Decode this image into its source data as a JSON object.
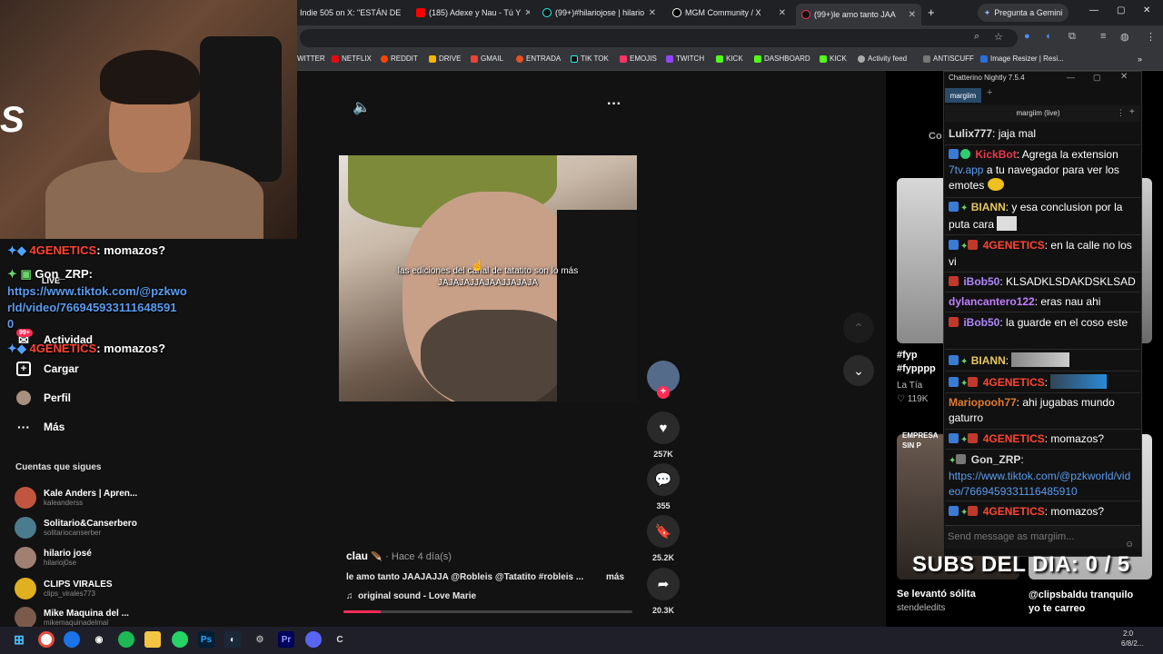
{
  "tabs": [
    {
      "label": "Indie 505 on X: \"ESTÁN DE",
      "icon": "x-icon"
    },
    {
      "label": "(185) Adexe y Nau - Tú Y",
      "icon": "youtube-icon"
    },
    {
      "label": "(99+)#hilariojose | hilario",
      "icon": "tiktok-icon"
    },
    {
      "label": "MGM Community / X",
      "icon": "x-icon"
    },
    {
      "label": "(99+)le amo tanto JAA",
      "icon": "tiktok-icon"
    }
  ],
  "gemini_label": "Pregunta a Gemini",
  "bookmarks": [
    "WITTER",
    "NETFLIX",
    "REDDIT",
    "DRIVE",
    "GMAIL",
    "ENTRADA",
    "TIK TOK",
    "EMOJIS",
    "TWITCH",
    "KICK",
    "DASHBOARD",
    "KICK",
    "Activity feed",
    "ANTISCUFF",
    "Image Resizer | Resi..."
  ],
  "sidebar": {
    "items": [
      {
        "label": "Actividad",
        "icon": "bell-icon",
        "badge": "99+"
      },
      {
        "label": "Cargar",
        "icon": "plus-square-icon"
      },
      {
        "label": "Perfil",
        "icon": "avatar-icon"
      },
      {
        "label": "Más",
        "icon": "more-icon"
      }
    ],
    "following_title": "Cuentas que sigues",
    "following": [
      {
        "name": "Kale Anders | Apren...",
        "user": "kaleanderss",
        "color": "#c2553f"
      },
      {
        "name": "Solitario&Canserbero",
        "user": "solitariocanserber",
        "color": "#4a7b8f"
      },
      {
        "name": "hilario josé",
        "user": "hilarioj0se",
        "color": "#a08070"
      },
      {
        "name": "CLIPS VIRALES",
        "user": "clips_virales773",
        "color": "#e0b020"
      },
      {
        "name": "Mike Maquina del ...",
        "user": "mikemaquinadelmal",
        "color": "#7a5a4a"
      }
    ]
  },
  "overlay_chat": {
    "line1_user": "4GENETICS",
    "line1_msg": ": momazos?",
    "line2_user": "Gon_ZRP:",
    "line2_link_a": "https://www.tiktok.com/@pzkwo",
    "line2_link_b": "rld/video/766945933111648591",
    "line2_link_c": "0",
    "line3_user": "4GENETICS",
    "line3_msg": ": momazos?",
    "live_label": "LIVE"
  },
  "video": {
    "caption": "las ediciones del canal de tatatito son lo más JAJAJAJJAJAAJJAJAJA",
    "author": "clau",
    "time": "· Hace 4 día(s)",
    "description": "le amo tanto JAAJAJJA @Robleis @Tatatito #robleis ...",
    "more": "más",
    "sound": "original sound - Love Marie",
    "progress": 0.13
  },
  "actions": {
    "likes": "257K",
    "comments": "355",
    "saves": "25.2K",
    "shares": "20.3K"
  },
  "chatterino": {
    "title": "Chatterino Nightly 7.5.4",
    "tab": "margiim",
    "channel": "margiim (live)",
    "input_placeholder": "Send message as margiim...",
    "messages": [
      {
        "user": "Lulix777",
        "color": "#dddddd",
        "text": ": jaja mal"
      },
      {
        "user": "KickBot",
        "color": "#e83a4a",
        "text": ": Agrega la extension",
        "link": "7tv.app",
        "text2": " a tu navegador para ver los emotes"
      },
      {
        "user": "BIANN",
        "color": "#e8c860",
        "text": ": y esa conclusion por la puta cara"
      },
      {
        "user": "4GENETICS",
        "color": "#ff4433",
        "text": ": en la calle no los vi"
      },
      {
        "user": "iBob50",
        "color": "#b088ff",
        "text": ": KLSADKLSDAKDSKLSAD"
      },
      {
        "user": "dylancantero122",
        "color": "#c080ff",
        "text": ": eras nau ahi"
      },
      {
        "user": "iBob50",
        "color": "#b088ff",
        "text": ": la guarde en el coso este"
      },
      {
        "user": "BIANN",
        "color": "#e8c860",
        "text": ":"
      },
      {
        "user": "4GENETICS",
        "color": "#ff4433",
        "text": ":"
      },
      {
        "user": "Mariopooh77",
        "color": "#e07a30",
        "text": ": ahi jugabas mundo gaturro"
      },
      {
        "user": "4GENETICS",
        "color": "#ff4433",
        "text": ": momazos?"
      },
      {
        "user": "Gon_ZRP",
        "color": "#dddddd",
        "text": ":",
        "link": "https://www.tiktok.com/@pzkworld/video/7669459331116485910"
      },
      {
        "user": "4GENETICS",
        "color": "#ff4433",
        "text": ": momazos?"
      }
    ]
  },
  "recommendations": {
    "section_label": "Co",
    "card1_title": "#fyp #fypppp",
    "card1_author": "La Tía",
    "card1_likes": "119K",
    "card2_title": "Se levantó sólita",
    "card2_author": "stendeledits",
    "card3_title": "@clipsbaldu tranquilo yo te carreo",
    "card3_overlay": "EMPRESA SIN P"
  },
  "subs_overlay": "SUBS DEL DIA: 0 / 5",
  "clock": {
    "time": "2:0",
    "date": "6/8/2..."
  },
  "colors": {
    "accent": "#fe2c55",
    "link": "#5a9cf0",
    "chat_bg": "#111111"
  }
}
